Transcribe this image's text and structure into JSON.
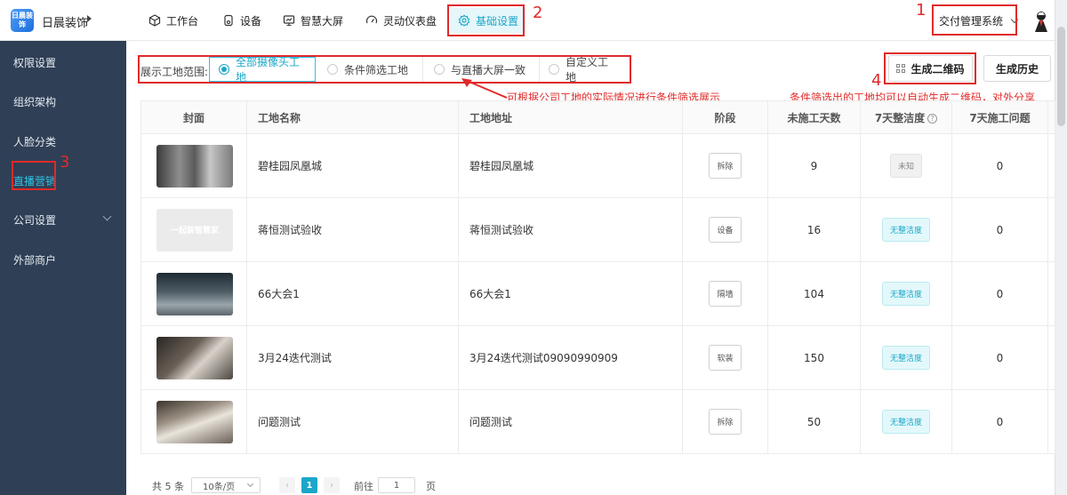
{
  "app": {
    "logo_text": "日晨装饰",
    "brand_name": "日晨装饰",
    "system_select": "交付管理系统"
  },
  "nav": [
    {
      "label": "工作台",
      "icon": "cube-icon"
    },
    {
      "label": "设备",
      "icon": "device-icon"
    },
    {
      "label": "智慧大屏",
      "icon": "monitor-icon"
    },
    {
      "label": "灵动仪表盘",
      "icon": "dashboard-icon"
    },
    {
      "label": "基础设置",
      "icon": "gear-icon",
      "active": true
    }
  ],
  "sidebar": {
    "items": [
      {
        "label": "权限设置"
      },
      {
        "label": "组织架构"
      },
      {
        "label": "人脸分类"
      },
      {
        "label": "直播营销",
        "active": true
      },
      {
        "label": "公司设置",
        "has_children": true
      },
      {
        "label": "外部商户"
      }
    ]
  },
  "filter": {
    "label": "展示工地范围:",
    "options": [
      "全部摄像头工地",
      "条件筛选工地",
      "与直播大屏一致",
      "自定义工地"
    ],
    "selected": "全部摄像头工地"
  },
  "buttons": {
    "generate_qr": "生成二维码",
    "history": "生成历史"
  },
  "annotations": {
    "n1": "1",
    "n2": "2",
    "n3": "3",
    "n4": "4",
    "note_filter": "可根据公司工地的实际情况进行条件筛选展示",
    "note_qr": "条件筛选出的工地均可以自动生成二维码，对外分享"
  },
  "table": {
    "headers": [
      "封面",
      "工地名称",
      "工地地址",
      "阶段",
      "未施工天数",
      "7天整洁度",
      "7天施工问题"
    ],
    "rows": [
      {
        "name": "碧桂园凤凰城",
        "address": "碧桂园凤凰城",
        "stage": "拆除",
        "idle_days": "9",
        "tidy": "未知",
        "problems": "0",
        "cover_text": ""
      },
      {
        "name": "蒋恒测试验收",
        "address": "蒋恒测试验收",
        "stage": "设备",
        "idle_days": "16",
        "tidy": "无整洁度",
        "problems": "0",
        "cover_text": "一起装智慧家"
      },
      {
        "name": "66大会1",
        "address": "66大会1",
        "stage": "隔墙",
        "idle_days": "104",
        "tidy": "无整洁度",
        "problems": "0",
        "cover_text": ""
      },
      {
        "name": "3月24迭代测试",
        "address": "3月24迭代测试09090990909",
        "stage": "软装",
        "idle_days": "150",
        "tidy": "无整洁度",
        "problems": "0",
        "cover_text": ""
      },
      {
        "name": "问题测试",
        "address": "问题测试",
        "stage": "拆除",
        "idle_days": "50",
        "tidy": "无整洁度",
        "problems": "0",
        "cover_text": ""
      }
    ]
  },
  "pagination": {
    "total": "共 5 条",
    "page_size": "10条/页",
    "current": "1",
    "goto_label": "前往",
    "goto_value": "1",
    "page_unit": "页"
  },
  "colors": {
    "accent": "#1aa7c8",
    "annotation": "#e02a2a",
    "sidebar_bg": "#2f3f55"
  }
}
